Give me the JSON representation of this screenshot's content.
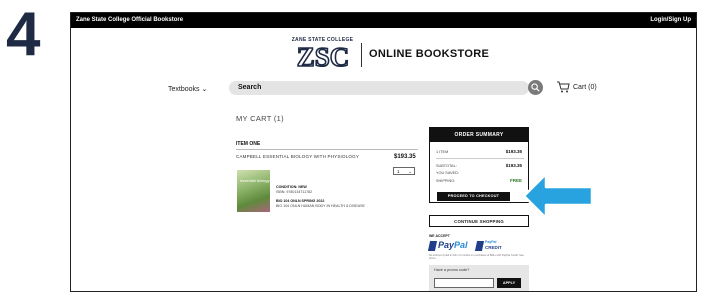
{
  "step_number": "4",
  "topbar": {
    "store_name": "Zane State College Official Bookstore",
    "login": "Login/Sign Up"
  },
  "logo": {
    "college": "ZANE STATE COLLEGE",
    "mark": "ZSC"
  },
  "brand": {
    "title": "ONLINE BOOKSTORE"
  },
  "nav": {
    "textbooks": "Textbooks",
    "search_label": "Search",
    "cart": "Cart (0)"
  },
  "cart": {
    "title": "MY CART (1)",
    "section": "ITEM ONE",
    "item": {
      "title": "CAMPBELL ESSENTIAL BIOLOGY WITH PHYSIOLOGY",
      "price": "$193.35",
      "qty": "1",
      "condition": "CONDITION: NEW",
      "isbn": "ISBN: 9780134711782",
      "course": "BIO 104 ONLN SPRING 2022",
      "course_desc": "BIO 104 ONLN HUMAN BODY IN HEALTH & DISEASE",
      "book_cover_text": "essential biology"
    }
  },
  "summary": {
    "header": "ORDER SUMMARY",
    "items_label": "1 ITEM",
    "items_value": "$193.35",
    "subtotal_label": "SUBTOTAL:",
    "subtotal_value": "$193.35",
    "saved_label": "YOU SAVED:",
    "shipping_label": "SHIPPING:",
    "shipping_value": "FREE",
    "checkout_button": "PROCEED TO CHECKOUT"
  },
  "continue_shopping": "CONTINUE SHOPPING",
  "payment": {
    "we_accept": "WE ACCEPT",
    "paypal_a": "Pay",
    "paypal_b": "Pal",
    "credit_top": "PayPal",
    "credit_bottom": "CREDIT",
    "fine_print": "No interest if paid in full in 6 months on purchases of $99+ with PayPal Credit. See terms."
  },
  "promo": {
    "label": "Have a promo code?",
    "apply": "APPLY"
  },
  "colors": {
    "arrow": "#29a3df",
    "brand_navy": "#1f2a44",
    "paypal_dark": "#1f3f8a",
    "paypal_light": "#2a8ad8"
  }
}
